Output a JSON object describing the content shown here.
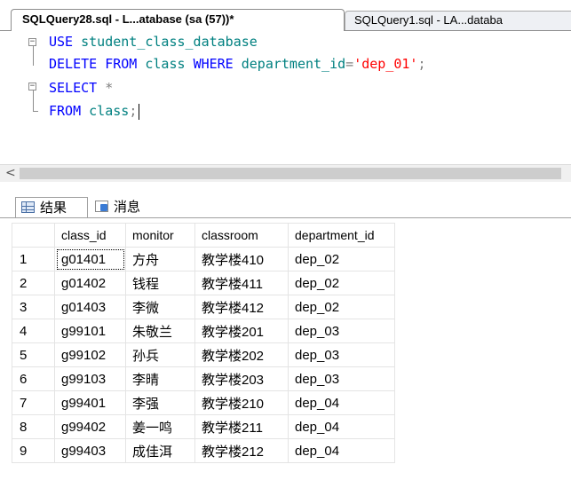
{
  "tabs": {
    "active": "SQLQuery28.sql - L...atabase (sa (57))*",
    "inactive": "SQLQuery1.sql - LA...databa"
  },
  "editor": {
    "line1": {
      "kw": "USE",
      "rest": "student_class_database"
    },
    "line2": {
      "kw1": "DELETE FROM",
      "tbl": "class",
      "kw2": "WHERE",
      "col": "department_id",
      "op": "=",
      "str": "'dep_01'",
      "end": ";"
    },
    "line3": {
      "kw": "SELECT",
      "star": "*"
    },
    "line4": {
      "kw": "FROM",
      "tbl": "class",
      "end": ";"
    }
  },
  "scrollbar": {
    "left_arrow": "<"
  },
  "result_tabs": {
    "results": "结果",
    "messages": "消息"
  },
  "grid": {
    "columns": [
      "class_id",
      "monitor",
      "classroom",
      "department_id"
    ],
    "rows": [
      {
        "n": "1",
        "class_id": "g01401",
        "monitor": "方舟",
        "classroom": "教学楼410",
        "department_id": "dep_02"
      },
      {
        "n": "2",
        "class_id": "g01402",
        "monitor": "钱程",
        "classroom": "教学楼411",
        "department_id": "dep_02"
      },
      {
        "n": "3",
        "class_id": "g01403",
        "monitor": "李微",
        "classroom": "教学楼412",
        "department_id": "dep_02"
      },
      {
        "n": "4",
        "class_id": "g99101",
        "monitor": "朱敬兰",
        "classroom": "教学楼201",
        "department_id": "dep_03"
      },
      {
        "n": "5",
        "class_id": "g99102",
        "monitor": "孙兵",
        "classroom": "教学楼202",
        "department_id": "dep_03"
      },
      {
        "n": "6",
        "class_id": "g99103",
        "monitor": "李晴",
        "classroom": "教学楼203",
        "department_id": "dep_03"
      },
      {
        "n": "7",
        "class_id": "g99401",
        "monitor": "李强",
        "classroom": "教学楼210",
        "department_id": "dep_04"
      },
      {
        "n": "8",
        "class_id": "g99402",
        "monitor": "姜一鸣",
        "classroom": "教学楼211",
        "department_id": "dep_04"
      },
      {
        "n": "9",
        "class_id": "g99403",
        "monitor": "成佳洱",
        "classroom": "教学楼212",
        "department_id": "dep_04"
      }
    ]
  }
}
